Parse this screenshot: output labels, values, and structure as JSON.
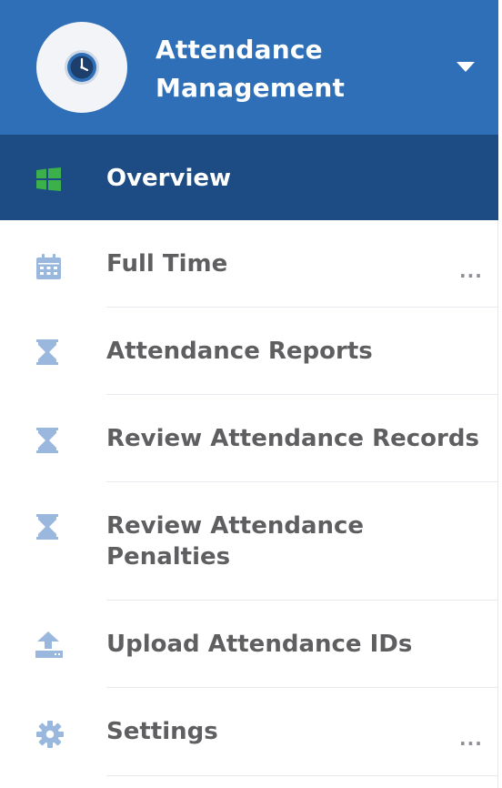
{
  "header": {
    "title_line1": "Attendance",
    "title_line2": "Management",
    "logo_icon": "clock-icon",
    "caret_icon": "caret-down-icon",
    "background": "#2f6fb7"
  },
  "nav": {
    "active": {
      "label": "Overview",
      "icon": "windows-grid-icon",
      "background": "#1c4c83",
      "icon_color": "#3cb04a"
    },
    "items": [
      {
        "label": "Full Time",
        "icon": "calendar-icon",
        "more": "..."
      },
      {
        "label": "Attendance Reports",
        "icon": "hourglass-icon"
      },
      {
        "label": "Review Attendance Records",
        "icon": "hourglass-icon"
      },
      {
        "label_line1": "Review Attendance",
        "label_line2": "Penalties",
        "icon": "hourglass-icon"
      },
      {
        "label": "Upload Attendance IDs",
        "icon": "upload-icon"
      },
      {
        "label": "Settings",
        "icon": "gear-icon",
        "more": "..."
      }
    ],
    "icon_color": "#9ab8de",
    "text_color": "#5f5f62"
  }
}
